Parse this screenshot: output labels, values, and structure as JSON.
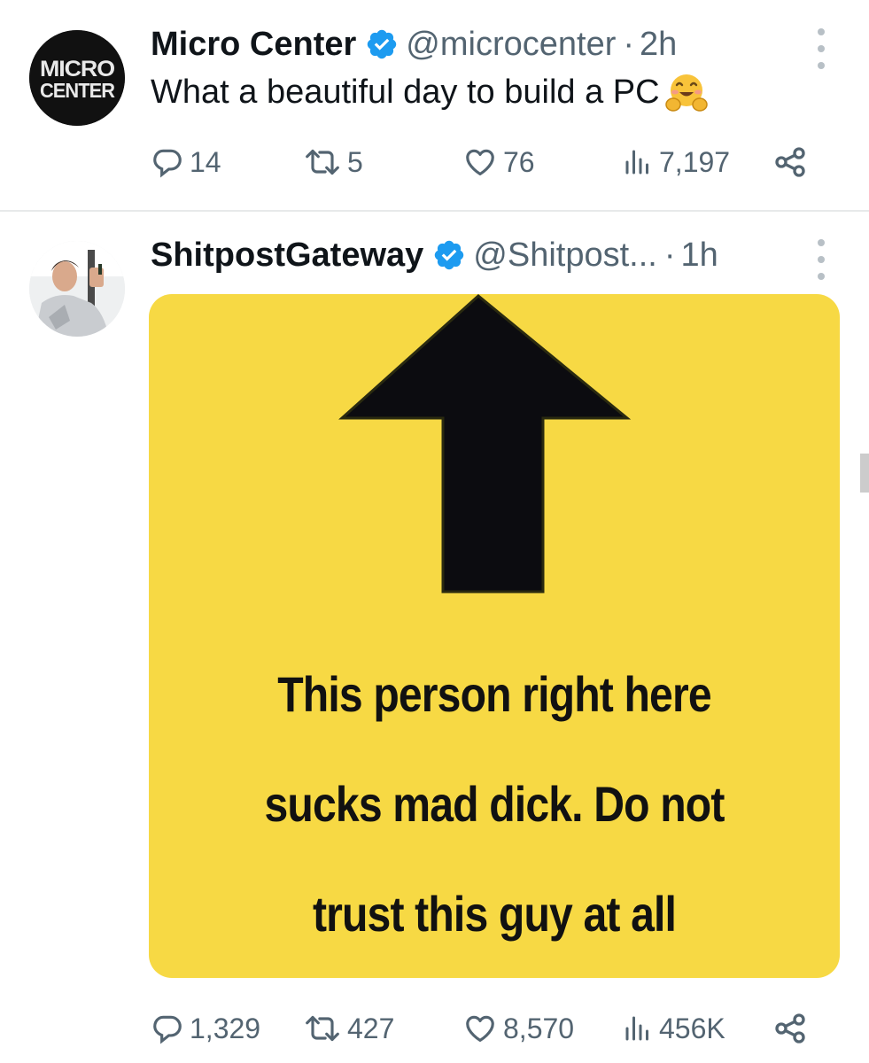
{
  "tweets": [
    {
      "display_name": "Micro Center",
      "handle": "@microcenter",
      "separator": "·",
      "time": "2h",
      "text": "What a beautiful day to build a PC",
      "avatar_logo": {
        "line1": "MICRO",
        "line2": "CENTER"
      },
      "emoji": "hugging-face-emoji",
      "replies": "14",
      "reposts": "5",
      "likes": "76",
      "views": "7,197"
    },
    {
      "display_name": "ShitpostGateway",
      "handle": "@Shitpost...",
      "separator": "·",
      "time": "1h",
      "media": {
        "lines": [
          "This person right here",
          "sucks mad dick. Do not",
          "trust this guy at all"
        ],
        "background_color": "#f7d944",
        "arrow": "up-arrow"
      },
      "replies": "1,329",
      "reposts": "427",
      "likes": "8,570",
      "views": "456K"
    }
  ],
  "colors": {
    "verified": "#1d9bf0",
    "secondary_text": "#536471",
    "divider": "#e7e9ea"
  }
}
